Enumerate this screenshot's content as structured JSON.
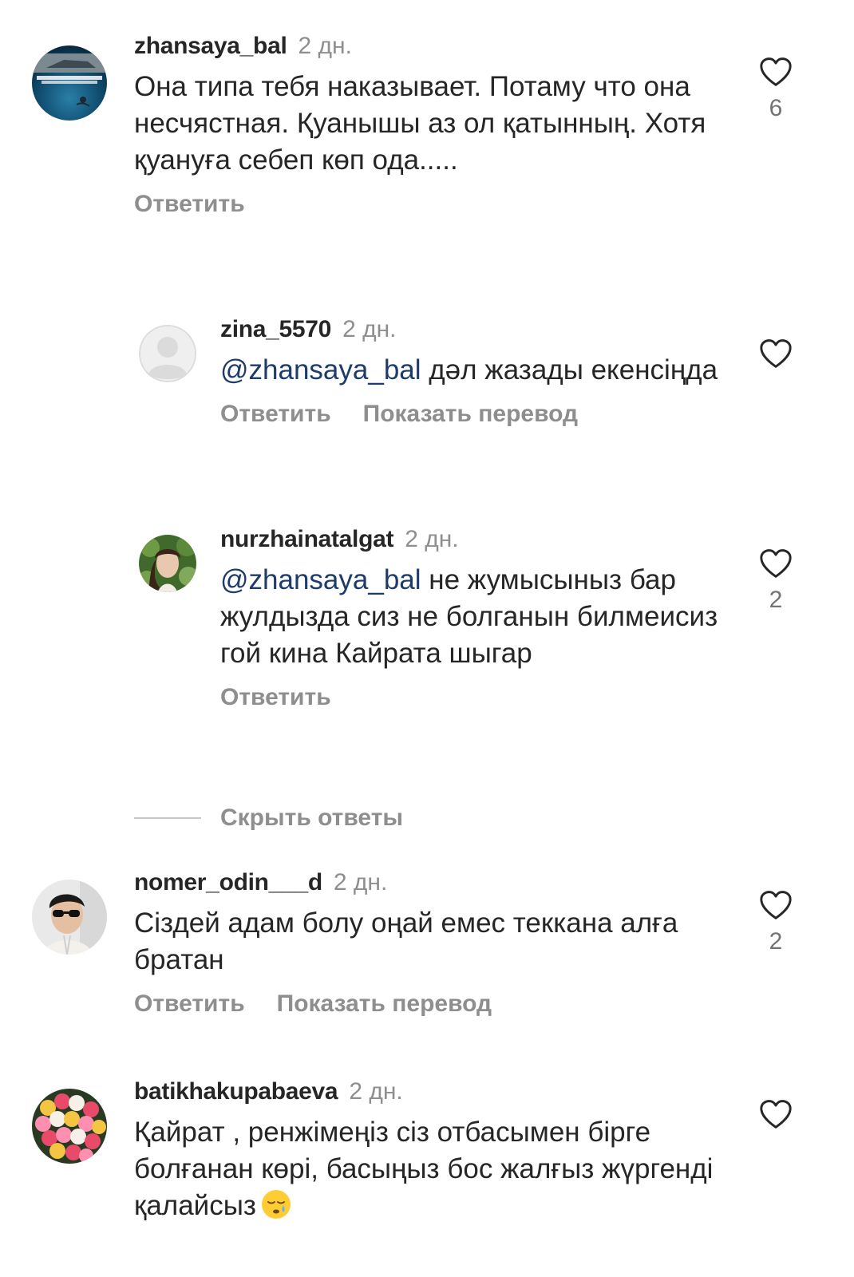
{
  "comments": [
    {
      "username": "zhansaya_bal",
      "time": "2 дн.",
      "text": "Она типа тебя наказывает. Потаму что она несчястная. Қуанышы аз ол қатынның. Хотя қуануға себеп көп ода.....",
      "reply": "Ответить",
      "likes": "6"
    },
    {
      "username": "zina_5570",
      "time": "2 дн.",
      "mention": "@zhansaya_bal",
      "text": " дәл жазады екенсіңда",
      "reply": "Ответить",
      "translate": "Показать перевод"
    },
    {
      "username": "nurzhainatalgat",
      "time": "2 дн.",
      "mention": "@zhansaya_bal",
      "text": "  не жумысыныз бар жулдызда сиз не болганын билмеисиз гой кина Кайрата шыгар",
      "reply": "Ответить",
      "likes": "2"
    },
    {
      "username": "nomer_odin___d",
      "time": "2 дн.",
      "text": "Сіздей адам болу оңай емес теккана алға братан",
      "reply": "Ответить",
      "translate": "Показать перевод",
      "likes": "2"
    },
    {
      "username": "batikhakupabaeva",
      "time": "2 дн.",
      "text": "Қайрат , ренжімеңіз сіз отбасымен бірге болғанан көрі, басыңыз бос жалғыз жүргенді қалайсыз",
      "emoji": "sleepy-face-emoji"
    }
  ],
  "hide_replies": "Скрыть ответы",
  "icons": {
    "like": "heart-outline-icon"
  },
  "colors": {
    "text": "#262626",
    "secondary": "#8e8e8e",
    "mention": "#1d3b6b"
  }
}
